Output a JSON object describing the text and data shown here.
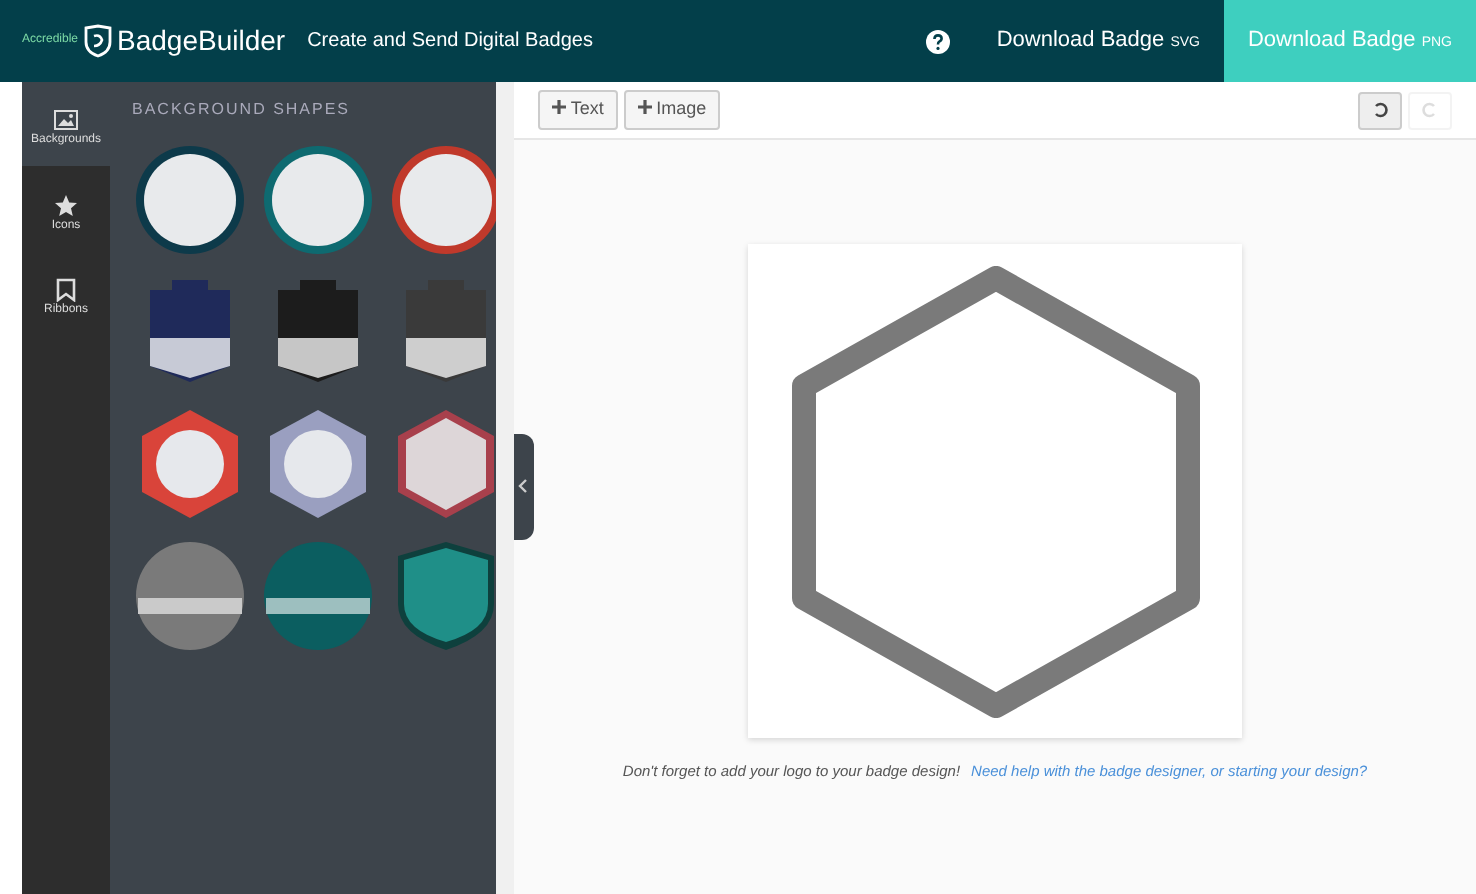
{
  "header": {
    "brand_small": "Accredible",
    "brand": "BadgeBuilder",
    "tagline": "Create and Send Digital Badges",
    "downloads": [
      {
        "label": "Download Badge",
        "format": "SVG",
        "primary": false
      },
      {
        "label": "Download Badge",
        "format": "PNG",
        "primary": true
      }
    ]
  },
  "sidebar": {
    "items": [
      {
        "kind": "image",
        "label": "Backgrounds",
        "selected": true
      },
      {
        "kind": "star",
        "label": "Icons",
        "selected": false
      },
      {
        "kind": "bookmark",
        "label": "Ribbons",
        "selected": false
      }
    ]
  },
  "panel": {
    "title": "BACKGROUND SHAPES",
    "shapes": [
      {
        "kind": "circle",
        "color": "#0d3a4a"
      },
      {
        "kind": "circle",
        "color": "#0e6a70"
      },
      {
        "kind": "circle",
        "color": "#c0392b"
      },
      {
        "kind": "banner",
        "color": "#1f2a5a"
      },
      {
        "kind": "banner",
        "color": "#1c1c1c"
      },
      {
        "kind": "banner",
        "color": "#3a3a3a"
      },
      {
        "kind": "hexring",
        "color": "#d9443a"
      },
      {
        "kind": "hexring",
        "color": "#9a9fc0"
      },
      {
        "kind": "hexagon",
        "color": "#a8404c"
      },
      {
        "kind": "seal",
        "color": "#7a7a7a"
      },
      {
        "kind": "seal",
        "color": "#0b5e60"
      },
      {
        "kind": "shield",
        "color": "#1f8f88"
      }
    ]
  },
  "toolbar": {
    "buttons": [
      {
        "label": "Text"
      },
      {
        "label": "Image"
      }
    ],
    "history": [
      {
        "kind": "undo",
        "disabled": false
      },
      {
        "kind": "redo",
        "disabled": true
      }
    ]
  },
  "footer": {
    "note": "Don't forget to add your logo to your badge design!",
    "link": "Need help with the badge designer, or starting your design?"
  }
}
